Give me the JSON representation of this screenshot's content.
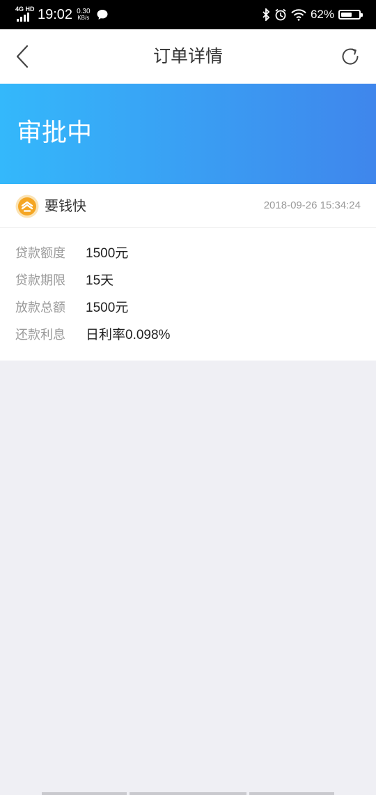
{
  "status_bar": {
    "network": "4G HD",
    "time": "19:02",
    "speed_value": "0.30",
    "speed_unit": "KB/s",
    "battery_percent": "62%",
    "battery_level": 0.62
  },
  "nav": {
    "title": "订单详情",
    "back_icon": "chevron-left-icon",
    "refresh_icon": "refresh-icon"
  },
  "banner": {
    "status": "审批中",
    "gradient_start": "#34b8fb",
    "gradient_end": "#3f86ec"
  },
  "order": {
    "product_name": "要钱快",
    "time": "2018-09-26 15:34:24",
    "logo_color": "#f5a623",
    "details": [
      {
        "label": "贷款额度",
        "value": "1500元"
      },
      {
        "label": "贷款期限",
        "value": "15天"
      },
      {
        "label": "放款总额",
        "value": "1500元"
      },
      {
        "label": "还款利息",
        "value": "日利率0.098%"
      }
    ]
  }
}
